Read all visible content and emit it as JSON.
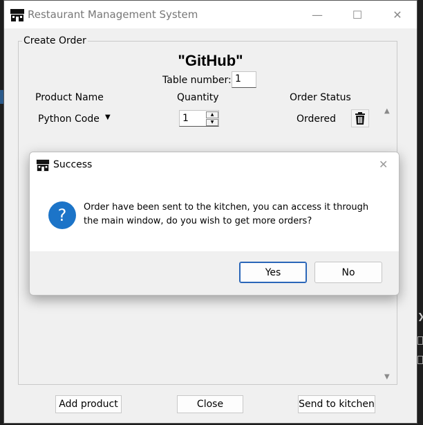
{
  "window": {
    "title": "Restaurant Management System",
    "controls": {
      "minimize_icon": "—",
      "maximize_icon": "☐",
      "close_icon": "✕"
    }
  },
  "create_order": {
    "group_label": "Create Order",
    "heading": "\"GitHub\"",
    "table_number_label": "Table number:",
    "table_number_value": "1",
    "columns": [
      "Product Name",
      "Quantity",
      "Order Status"
    ],
    "rows": [
      {
        "product": "Python Code",
        "quantity": "1",
        "status": "Ordered"
      }
    ]
  },
  "buttons": {
    "add_product": "Add product",
    "close": "Close",
    "send_to_kitchen": "Send to kitchen"
  },
  "dialog": {
    "title": "Success",
    "message": "Order have been sent to the kitchen, you can access it through the main window, do you wish to get more orders?",
    "yes_label": "Yes",
    "no_label": "No",
    "icon": "?"
  },
  "colors": {
    "accent": "#1c74c8",
    "default_button_border": "#2a66b8"
  }
}
